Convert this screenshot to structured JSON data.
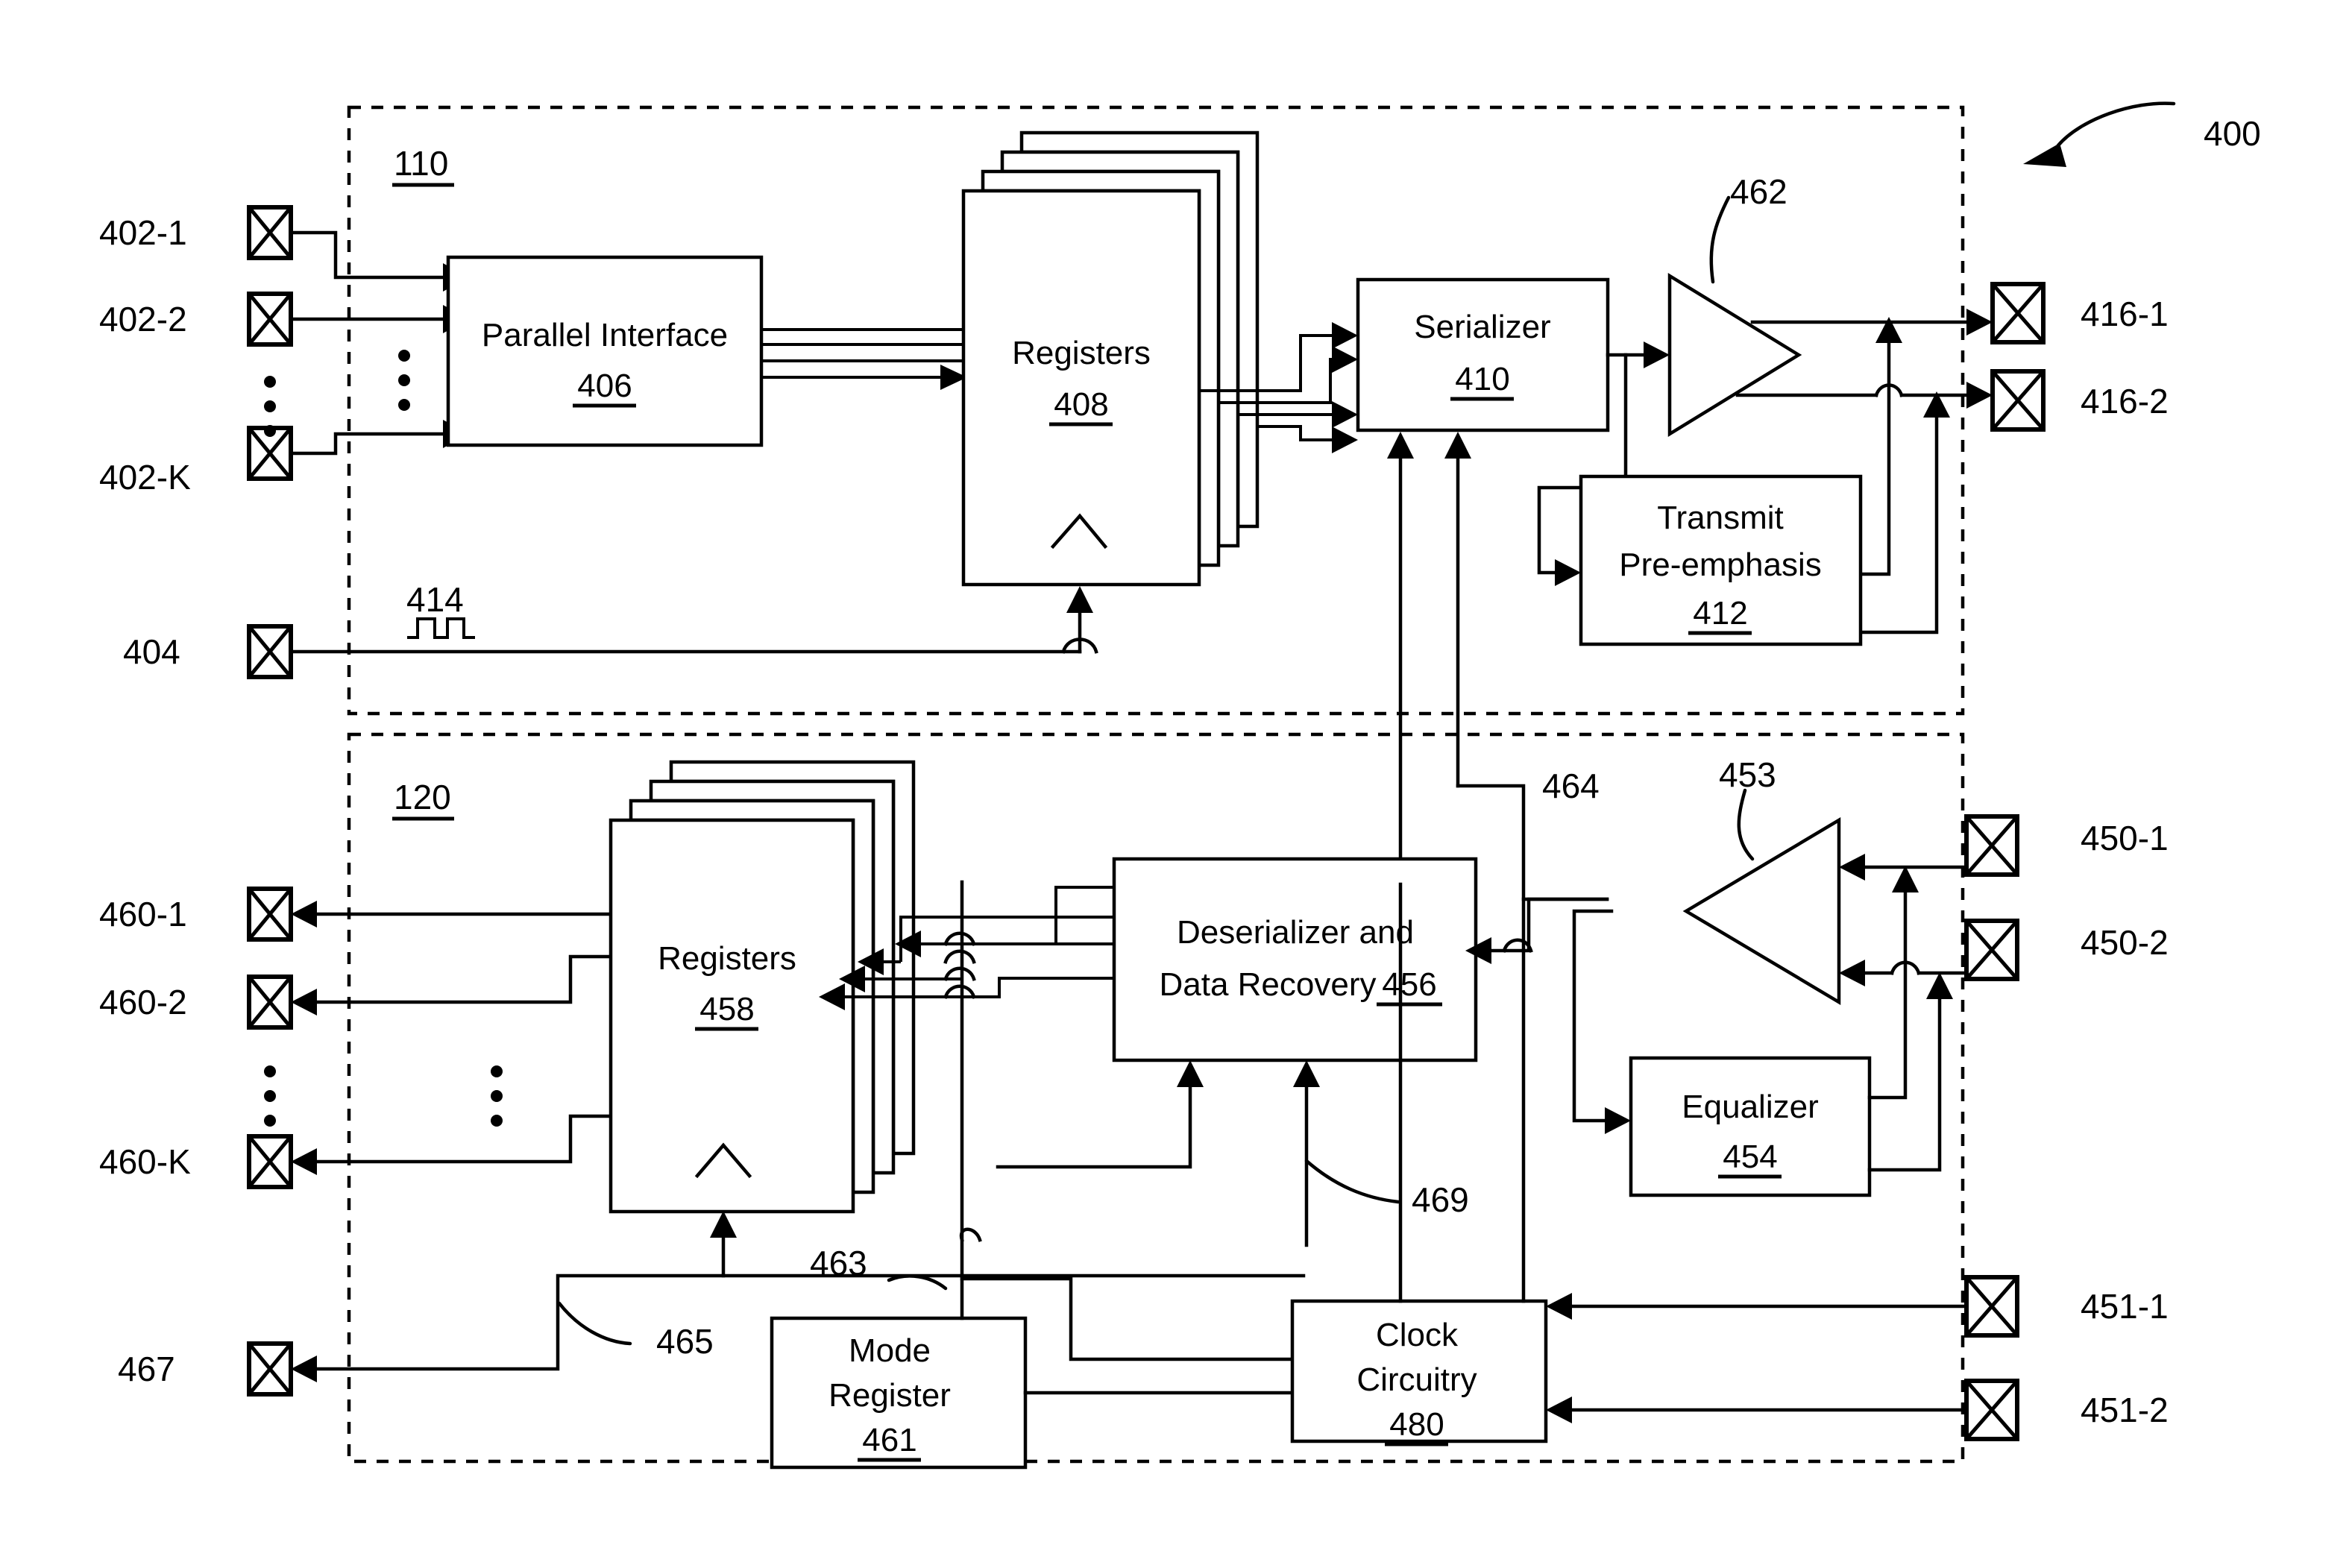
{
  "figure": {
    "number": "400",
    "sections": [
      {
        "id": "110",
        "role": "transmitter-section"
      },
      {
        "id": "120",
        "role": "receiver-section"
      }
    ]
  },
  "blocks": {
    "parallel_interface": {
      "title": "Parallel Interface",
      "ref": "406"
    },
    "registers_tx": {
      "title": "Registers",
      "ref": "408"
    },
    "serializer": {
      "title": "Serializer",
      "ref": "410"
    },
    "transmit_preemphasis": {
      "title_line1": "Transmit",
      "title_line2": "Pre-emphasis",
      "ref": "412"
    },
    "registers_rx": {
      "title": "Registers",
      "ref": "458"
    },
    "deserializer": {
      "title_line1": "Deserializer and",
      "title_line2": "Data Recovery",
      "ref": "456"
    },
    "equalizer": {
      "title": "Equalizer",
      "ref": "454"
    },
    "mode_register": {
      "title_line1": "Mode",
      "title_line2": "Register",
      "ref": "461"
    },
    "clock_circuitry": {
      "title_line1": "Clock",
      "title_line2": "Circuitry",
      "ref": "480"
    }
  },
  "amplifiers": {
    "tx_driver": {
      "ref": "462"
    },
    "rx_buffer": {
      "ref": "453"
    }
  },
  "pads": {
    "tx_parallel_in": [
      {
        "label": "402-1"
      },
      {
        "label": "402-2"
      },
      {
        "label": "402-K"
      }
    ],
    "tx_clock_in": {
      "label": "404"
    },
    "tx_serial_out": [
      {
        "label": "416-1"
      },
      {
        "label": "416-2"
      }
    ],
    "rx_parallel_out": [
      {
        "label": "460-1"
      },
      {
        "label": "460-2"
      },
      {
        "label": "460-K"
      }
    ],
    "rx_serial_in": [
      {
        "label": "450-1"
      },
      {
        "label": "450-2"
      }
    ],
    "rx_clock_in": [
      {
        "label": "451-1"
      },
      {
        "label": "451-2"
      }
    ],
    "rx_clock_out": {
      "label": "467"
    }
  },
  "signal_refs": {
    "tx_clock_waveform": "414",
    "rx_recovered_clock": "464",
    "mode_control": "463",
    "clock_out_path": "465",
    "deser_clock": "469"
  },
  "colors": {
    "line": "#000000",
    "background": "#ffffff"
  }
}
